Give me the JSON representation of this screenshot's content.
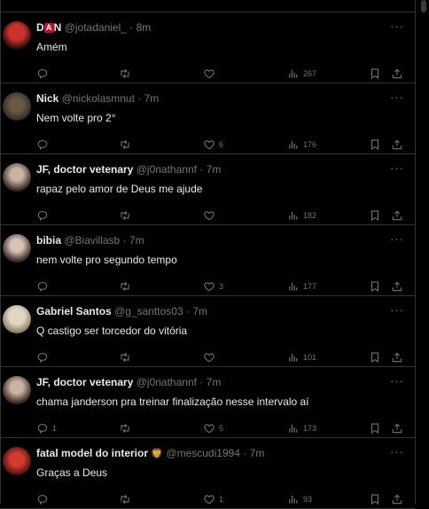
{
  "tweets": [
    {
      "name_prefix": "D",
      "name_badge": "A",
      "name_suffix": "N",
      "handle": "@jotadaniel_",
      "time": "8m",
      "text": "Amém",
      "replies": "",
      "retweets": "",
      "likes": "",
      "views": "267"
    },
    {
      "name": "Nick",
      "handle": "@nickolasmnut",
      "time": "7m",
      "text": "Nem volte pro 2°",
      "replies": "",
      "retweets": "",
      "likes": "6",
      "views": "176"
    },
    {
      "name": "JF, doctor vetenary",
      "handle": "@j0nathannf",
      "time": "7m",
      "text": "rapaz pelo amor de Deus me ajude",
      "replies": "",
      "retweets": "",
      "likes": "",
      "views": "182"
    },
    {
      "name": "bibia",
      "handle": "@Biavillasb",
      "time": "7m",
      "text": "nem volte pro segundo tempo",
      "replies": "",
      "retweets": "",
      "likes": "3",
      "views": "177"
    },
    {
      "name": "Gabriel Santos",
      "handle": "@g_santtos03",
      "time": "7m",
      "text": "Q castigo ser torcedor do vitória",
      "replies": "",
      "retweets": "",
      "likes": "",
      "views": "101"
    },
    {
      "name": "JF, doctor vetenary",
      "handle": "@j0nathannf",
      "time": "7m",
      "text": "chama janderson pra treinar finalização nesse intervalo aí",
      "replies": "1",
      "retweets": "",
      "likes": "5",
      "views": "173"
    },
    {
      "name": "fatal model do interior",
      "name_emoji": "🦁",
      "handle": "@mescudi1994",
      "time": "7m",
      "text": "Graças a Deus",
      "replies": "",
      "retweets": "",
      "likes": "1",
      "views": "93"
    }
  ],
  "separator": "·",
  "more_label": "···",
  "icons": {
    "reply": "reply-icon",
    "retweet": "retweet-icon",
    "like": "heart-icon",
    "views": "views-icon",
    "bookmark": "bookmark-icon",
    "share": "share-icon"
  }
}
